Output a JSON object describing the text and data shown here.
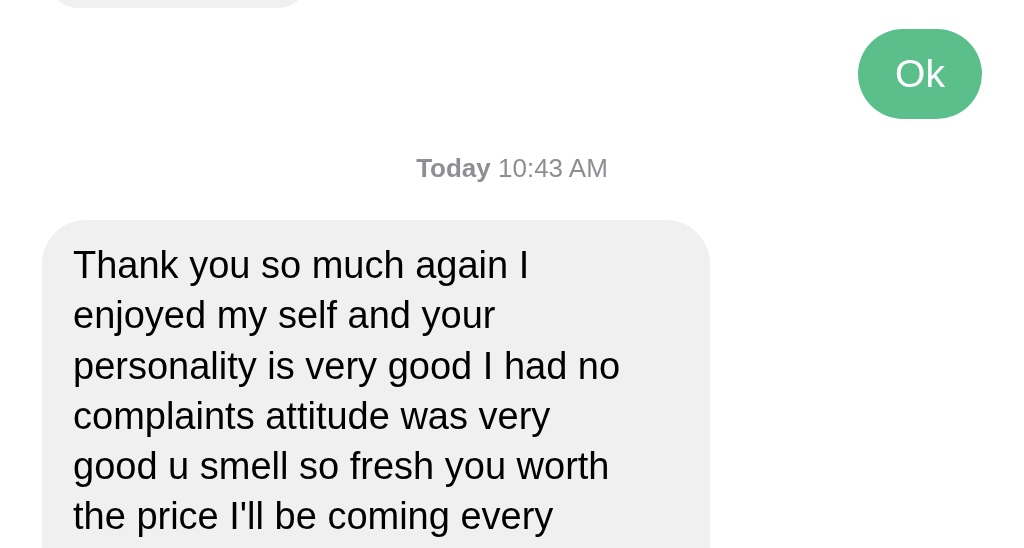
{
  "messages": [
    {
      "kind": "incoming"
    },
    {
      "kind": "outgoing",
      "text": "Ok"
    },
    {
      "kind": "timestamp",
      "day": "Today",
      "time": "10:43 AM"
    },
    {
      "kind": "incoming",
      "text": "Thank you so much again I enjoyed my self and your personality is very good I had no complaints attitude was very good u smell so fresh you worth the price I'll be coming every"
    }
  ]
}
